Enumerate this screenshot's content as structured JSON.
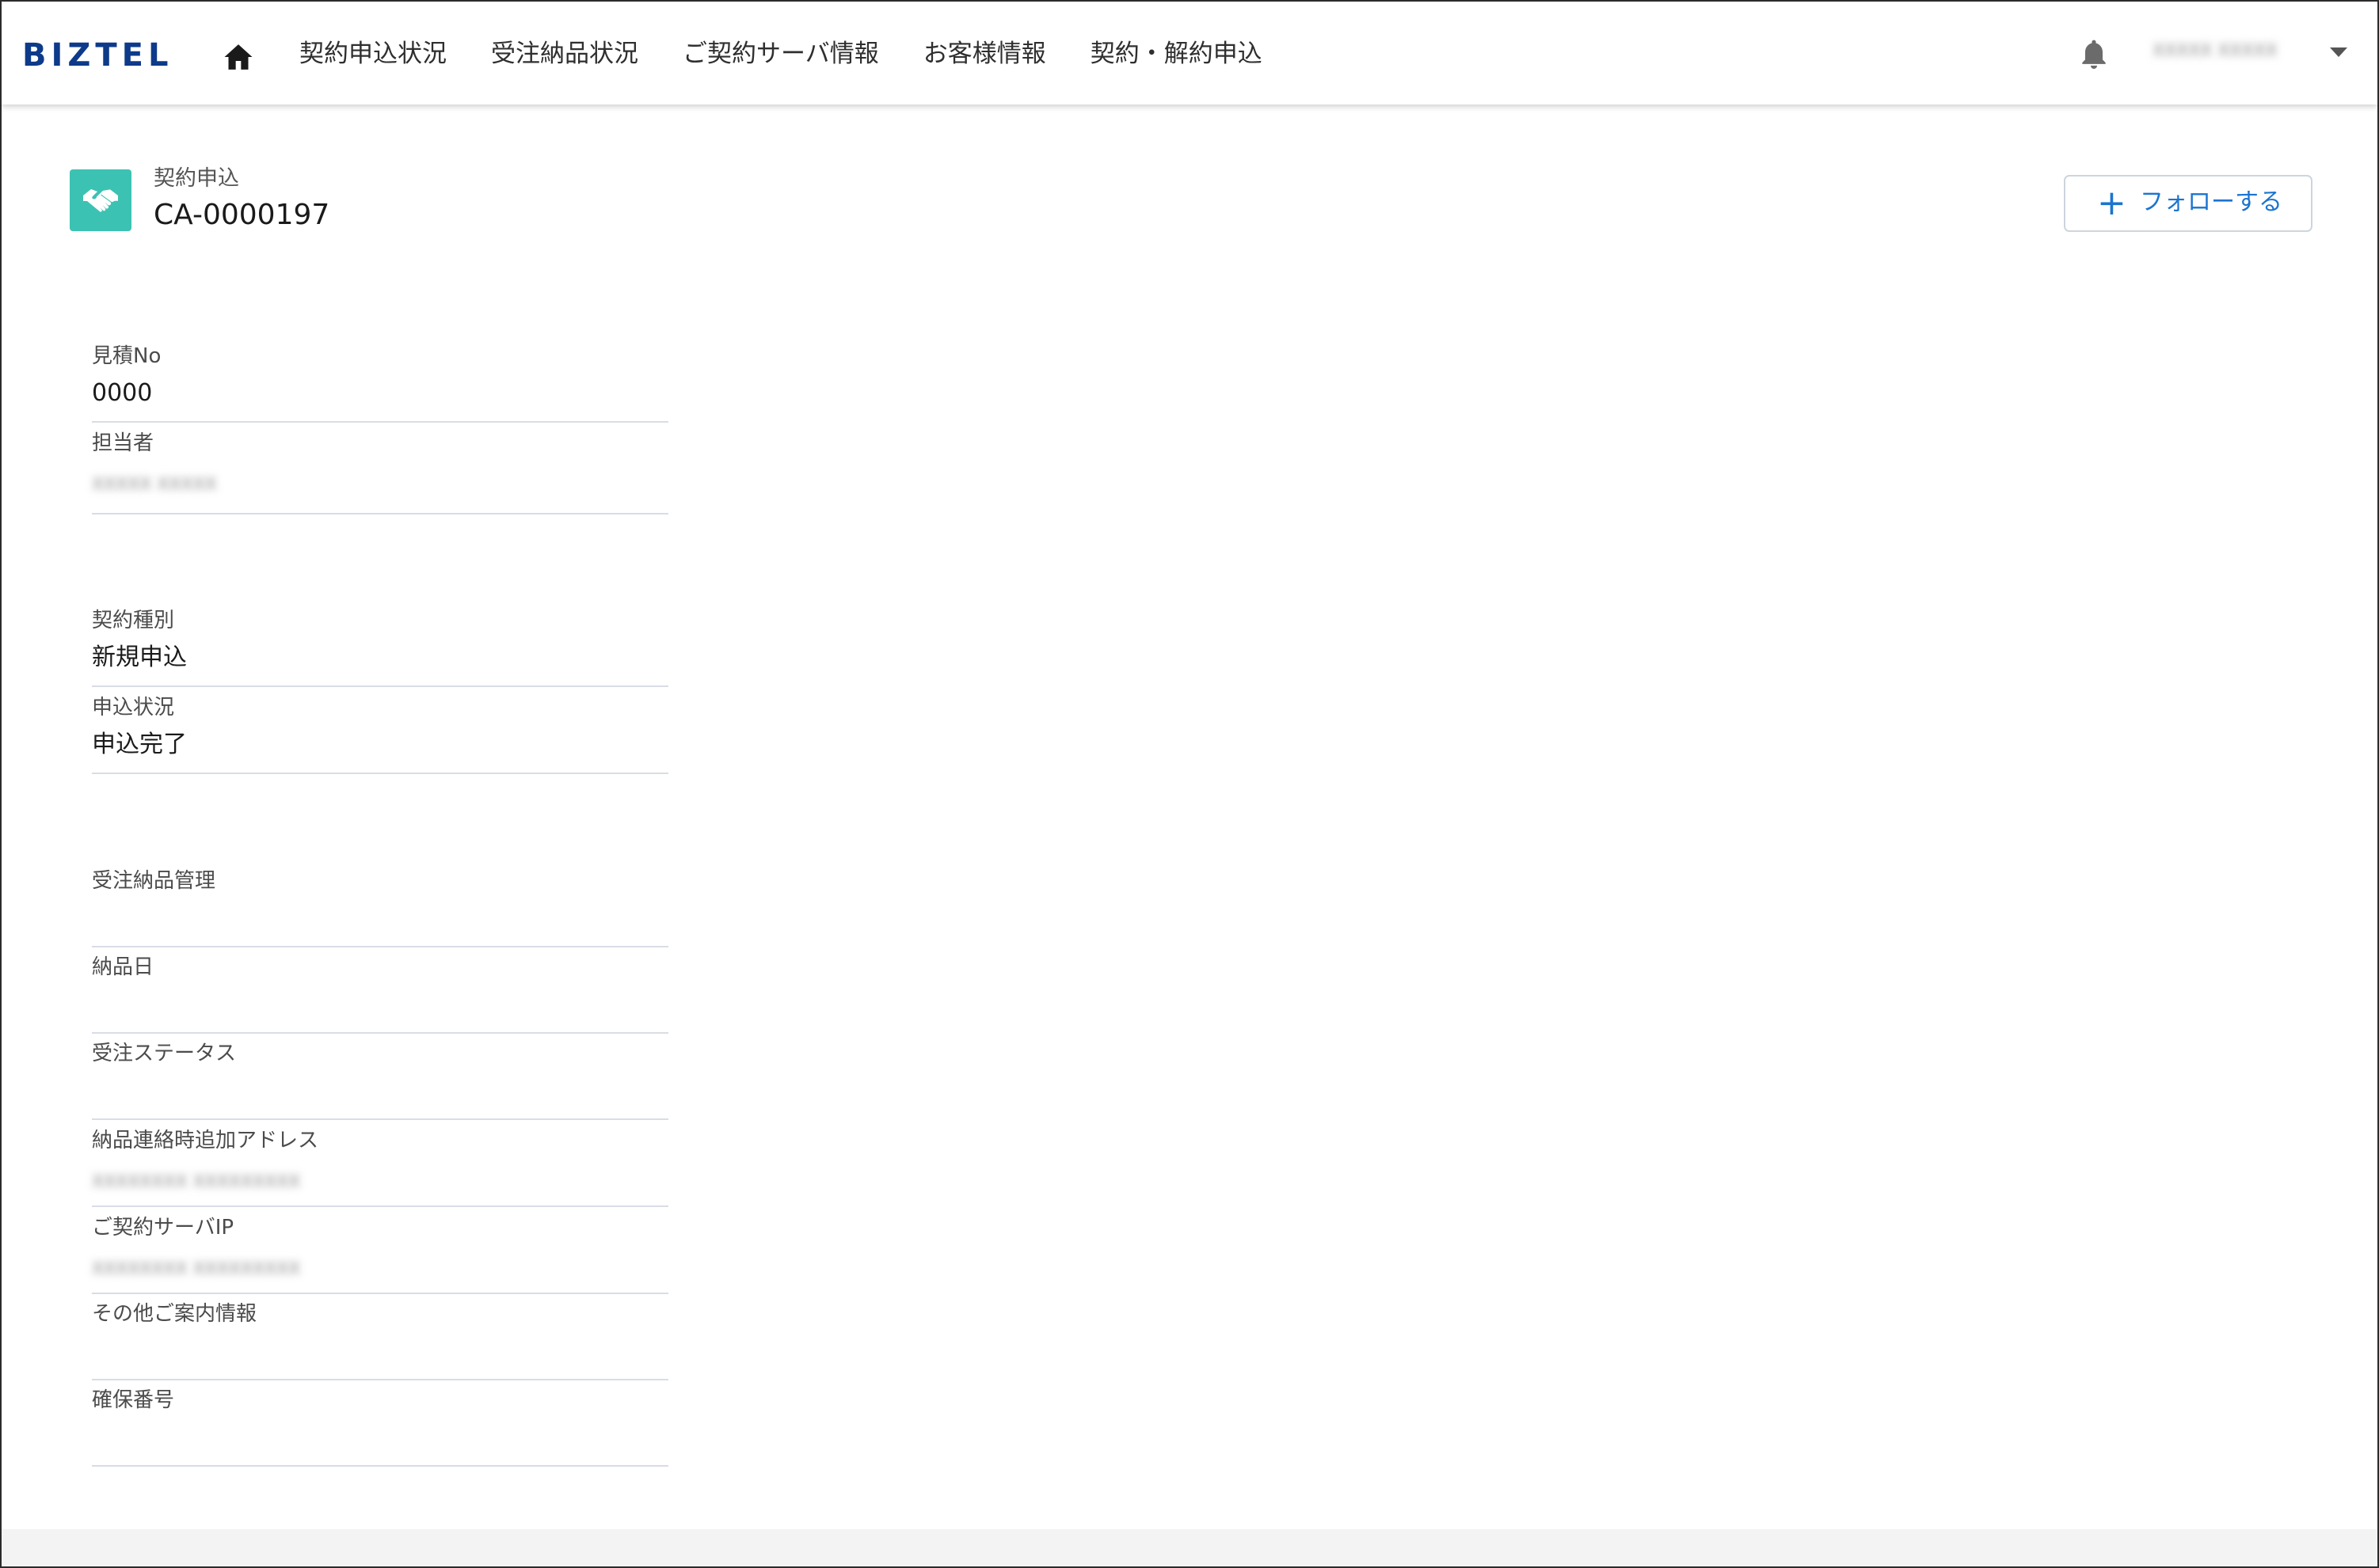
{
  "header": {
    "logo": "BIZTEL",
    "nav": [
      "契約申込状況",
      "受注納品状況",
      "ご契約サーバ情報",
      "お客様情報",
      "契約・解約申込"
    ],
    "user_name": "XXXXX XXXXX"
  },
  "record": {
    "type_label": "契約申込",
    "title": "CA-0000197",
    "follow_label": "フォローする",
    "follow_plus": "+"
  },
  "fields": [
    {
      "label": "見積No",
      "value": "0000"
    },
    {
      "label": "担当者",
      "value": "XXXXX XXXXX"
    },
    {
      "label": "契約種別",
      "value": "新規申込"
    },
    {
      "label": "申込状況",
      "value": "申込完了"
    },
    {
      "label": "受注納品管理",
      "value": ""
    },
    {
      "label": "納品日",
      "value": ""
    },
    {
      "label": "受注ステータス",
      "value": ""
    },
    {
      "label": "納品連絡時追加アドレス",
      "value": "XXXXXXXX XXXXXXXXX"
    },
    {
      "label": "ご契約サーバIP",
      "value": "XXXXXXXX XXXXXXXXX"
    },
    {
      "label": "その他ご案内情報",
      "value": ""
    },
    {
      "label": "確保番号",
      "value": ""
    }
  ],
  "colors": {
    "brand": "#0d3a8a",
    "accent": "#1b74cf",
    "record_icon": "#3cc2b2"
  },
  "icons": [
    "home-icon",
    "bell-icon",
    "caret-down-icon",
    "handshake-icon",
    "plus-icon"
  ]
}
